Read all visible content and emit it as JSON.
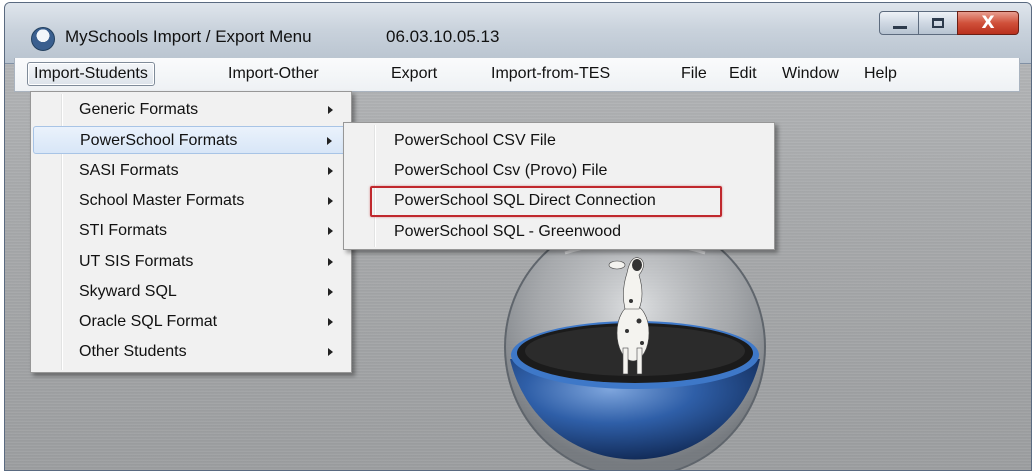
{
  "window": {
    "title": "MySchools Import / Export Menu",
    "version": "06.03.10.05.13",
    "close_glyph": "X"
  },
  "menubar": {
    "items": [
      {
        "label": "Import-Students",
        "active": true
      },
      {
        "label": "Import-Other"
      },
      {
        "label": "Export"
      },
      {
        "label": "Import-from-TES"
      },
      {
        "label": "File"
      },
      {
        "label": "Edit"
      },
      {
        "label": "Window"
      },
      {
        "label": "Help"
      }
    ]
  },
  "dropdown": {
    "items": [
      {
        "label": "Generic Formats"
      },
      {
        "label": "PowerSchool Formats",
        "highlighted": true
      },
      {
        "label": "SASI Formats"
      },
      {
        "label": "School Master Formats"
      },
      {
        "label": "STI Formats"
      },
      {
        "label": "UT SIS Formats"
      },
      {
        "label": "Skyward SQL"
      },
      {
        "label": "Oracle SQL Format"
      },
      {
        "label": "Other Students"
      }
    ]
  },
  "submenu": {
    "items": [
      {
        "label": "PowerSchool CSV File"
      },
      {
        "label": "PowerSchool Csv (Provo) File"
      },
      {
        "label": "PowerSchool SQL Direct Connection",
        "annotated": true
      },
      {
        "label": "PowerSchool SQL - Greenwood"
      }
    ]
  },
  "colors": {
    "annotation_box": "#c0282d",
    "highlight_bg": "#d8e6f7",
    "globe_blue": "#2f5fa8"
  }
}
